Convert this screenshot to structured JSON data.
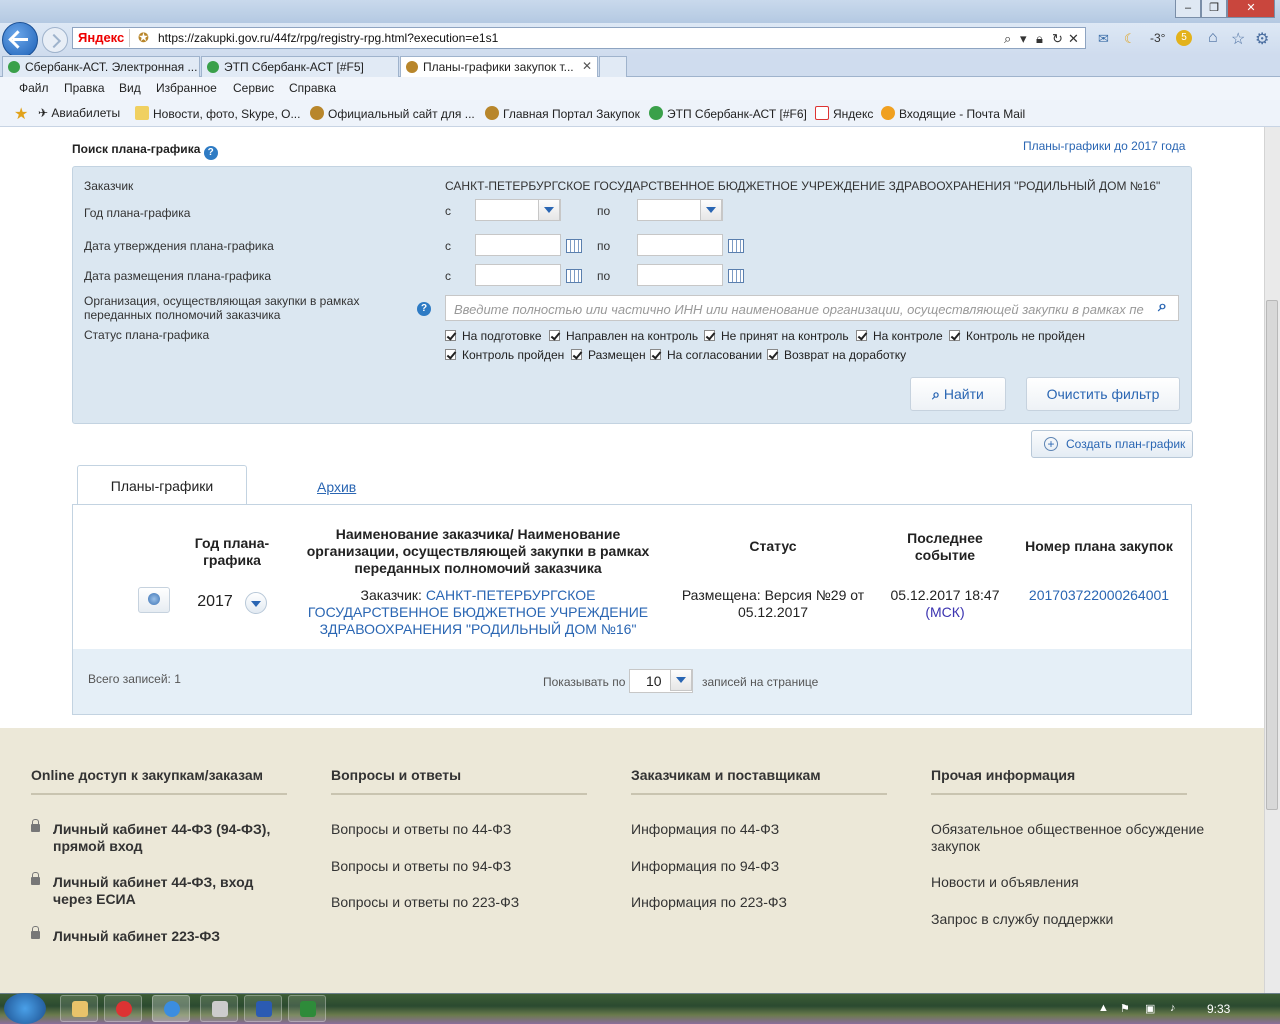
{
  "browser": {
    "address_url": "https://zakupki.gov.ru/44fz/rpg/registry-rpg.html?execution=e1s1",
    "search_engine_logo": "Яндекс",
    "weather": "-3°",
    "badge_count": "5",
    "tabs": [
      {
        "label": "Сбербанк-АСТ. Электронная ...",
        "icon": "sberbank-icon",
        "color": "#3aa04a"
      },
      {
        "label": "ЭТП Сбербанк-АСТ [#F5]",
        "icon": "sberbank-icon",
        "color": "#3aa04a"
      },
      {
        "label": "Планы-графики закупок т...",
        "icon": "emblem-icon",
        "color": "#b8862b"
      }
    ],
    "menu": [
      "Файл",
      "Правка",
      "Вид",
      "Избранное",
      "Сервис",
      "Справка"
    ],
    "favorites": [
      {
        "label": "Авиабилеты",
        "icon": "plane-icon"
      },
      {
        "label": "Новости, фото, Skype, О...",
        "icon": "page-icon"
      },
      {
        "label": "Официальный сайт для ...",
        "icon": "emblem-icon"
      },
      {
        "label": "Главная Портал Закупок",
        "icon": "emblem-icon"
      },
      {
        "label": "ЭТП Сбербанк-АСТ [#F6]",
        "icon": "sberbank-icon"
      },
      {
        "label": "Яндекс",
        "icon": "yandex-icon"
      },
      {
        "label": "Входящие - Почта Mail",
        "icon": "mail-icon"
      }
    ]
  },
  "search": {
    "title": "Поиск плана-графика",
    "help": "?",
    "old_plans_link": "Планы-графики до 2017 года",
    "customer_label": "Заказчик",
    "customer_value": "САНКТ-ПЕТЕРБУРГСКОЕ ГОСУДАРСТВЕННОЕ БЮДЖЕТНОЕ УЧРЕЖДЕНИЕ ЗДРАВООХРАНЕНИЯ \"РОДИЛЬНЫЙ ДОМ №16\"",
    "year_label": "Год плана-графика",
    "approval_label": "Дата утверждения плана-графика",
    "placement_label": "Дата размещения плана-графика",
    "from": "с",
    "to": "по",
    "org_label": "Организация, осуществляющая закупки в рамках переданных полномочий заказчика",
    "org_placeholder": "Введите полностью или частично ИНН или наименование организации, осуществляющей закупки в рамках пе",
    "status_label": "Статус плана-графика",
    "statuses_row1": [
      "На подготовке",
      "Направлен на контроль",
      "Не принят на контроль",
      "На контроле",
      "Контроль не пройден"
    ],
    "statuses_row2": [
      "Контроль пройден",
      "Размещен",
      "На согласовании",
      "Возврат на доработку"
    ],
    "find_button": "Найти",
    "clear_button": "Очистить фильтр",
    "create_button": "Создать план-график"
  },
  "tabs": {
    "plans": "Планы-графики",
    "archive": "Архив"
  },
  "table": {
    "headers": {
      "year": "Год плана-графика",
      "name": "Наименование заказчика/ Наименование организации, осуществляющей закупки в рамках переданных полномочий заказчика",
      "status": "Статус",
      "last_event": "Последнее событие",
      "plan_number": "Номер плана закупок"
    },
    "row": {
      "year": "2017",
      "customer_prefix": "Заказчик:",
      "customer_name": "САНКТ-ПЕТЕРБУРГСКОЕ ГОСУДАРСТВЕННОЕ БЮДЖЕТНОЕ УЧРЕЖДЕНИЕ ЗДРАВООХРАНЕНИЯ \"РОДИЛЬНЫЙ ДОМ №16\"",
      "status": "Размещена: Версия №29 от 05.12.2017",
      "last_event_date": "05.12.2017 18:47",
      "last_event_tz": "(МСК)",
      "plan_number": "201703722000264001"
    },
    "total": "Всего записей: 1",
    "show_label": "Показывать по",
    "page_size": "10",
    "per_page_label": "записей на странице"
  },
  "footer": {
    "columns": [
      {
        "title": "Online доступ к закупкам/заказам",
        "links": [
          "Личный кабинет 44-ФЗ (94-ФЗ), прямой вход",
          "Личный кабинет 44-ФЗ, вход через ЕСИА",
          "Личный кабинет 223-ФЗ"
        ]
      },
      {
        "title": "Вопросы и ответы",
        "links": [
          "Вопросы и ответы по 44-ФЗ",
          "Вопросы и ответы по 94-ФЗ",
          "Вопросы и ответы по 223-ФЗ"
        ]
      },
      {
        "title": "Заказчикам и поставщикам",
        "links": [
          "Информация по 44-ФЗ",
          "Информация по 94-ФЗ",
          "Информация по 223-ФЗ"
        ]
      },
      {
        "title": "Прочая информация",
        "links": [
          "Обязательное общественное обсуждение закупок",
          "Новости и объявления",
          "Запрос в службу поддержки"
        ]
      }
    ]
  },
  "taskbar": {
    "clock": "9:33"
  }
}
